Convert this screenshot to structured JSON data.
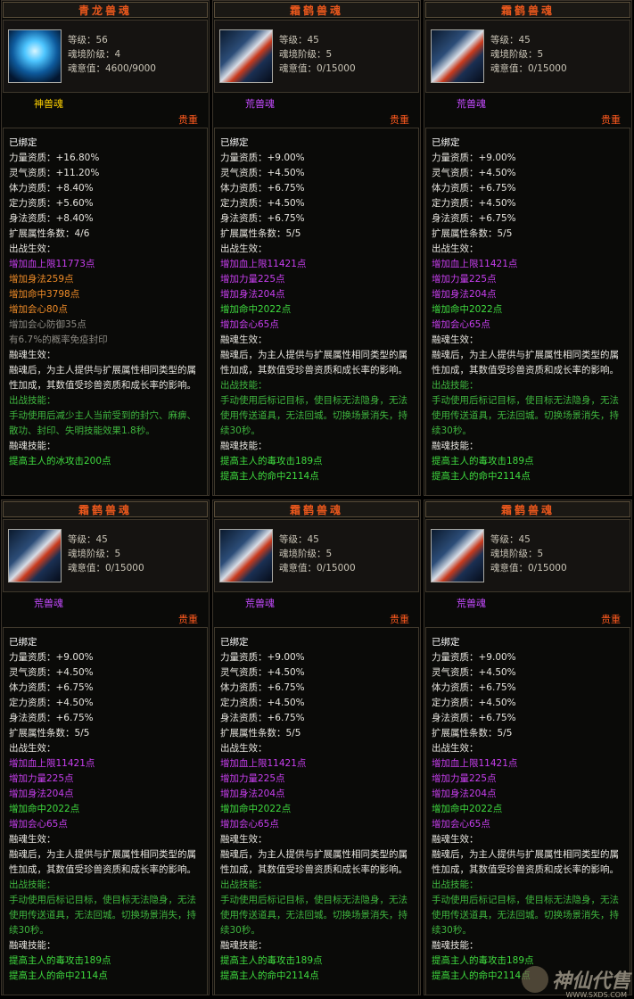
{
  "cards": [
    {
      "title": "青龙兽魂",
      "icon": "azure-dragon-soul-icon",
      "level": "等级：56",
      "stage": "魂境阶级：4",
      "soul_value": "魂意值：4600/9000",
      "type": "神兽魂",
      "rarity": "贵重",
      "bound": "已绑定",
      "attrs": [
        "力量资质：+16.80%",
        "灵气资质：+11.20%",
        "体力资质：+8.40%",
        "定力资质：+5.60%",
        "身法资质：+8.40%"
      ],
      "ext_count": "扩展属性条数：4/6",
      "battle_effect_label": "出战生效：",
      "effects": [
        {
          "text": "增加血上限11773点",
          "color": "p"
        },
        {
          "text": "增加身法259点",
          "color": "o"
        },
        {
          "text": "增加命中3798点",
          "color": "o"
        },
        {
          "text": "增加会心80点",
          "color": "o"
        },
        {
          "text": "增加会心防御35点",
          "color": "gr"
        },
        {
          "text": "有6.7%的概率免疫封印",
          "color": "gr"
        }
      ],
      "fusion_label": "融魂生效：",
      "fusion_text": "融魂后，为主人提供与扩展属性相同类型的属性加成，其数值受珍兽资质和成长率的影响。",
      "battle_skill_label": "出战技能：",
      "battle_skill_text": "手动使用后减少主人当前受到的封穴、麻痹、散功、封印、失明技能效果1.8秒。",
      "fusion_skill_label": "融魂技能：",
      "fusion_skill_lines": [
        "提高主人的冰攻击200点"
      ]
    },
    {
      "title": "霜鹤兽魂",
      "icon": "frost-crane-soul-icon",
      "level": "等级：45",
      "stage": "魂境阶级：5",
      "soul_value": "魂意值：0/15000",
      "type": "荒兽魂",
      "rarity": "贵重",
      "bound": "已绑定",
      "attrs": [
        "力量资质：+9.00%",
        "灵气资质：+4.50%",
        "体力资质：+6.75%",
        "定力资质：+4.50%",
        "身法资质：+6.75%"
      ],
      "ext_count": "扩展属性条数：5/5",
      "battle_effect_label": "出战生效：",
      "effects": [
        {
          "text": "增加血上限11421点",
          "color": "p"
        },
        {
          "text": "增加力量225点",
          "color": "p"
        },
        {
          "text": "增加身法204点",
          "color": "p"
        },
        {
          "text": "增加命中2022点",
          "color": "g"
        },
        {
          "text": "增加会心65点",
          "color": "p"
        }
      ],
      "fusion_label": "融魂生效：",
      "fusion_text": "融魂后，为主人提供与扩展属性相同类型的属性加成，其数值受珍兽资质和成长率的影响。",
      "battle_skill_label": "出战技能：",
      "battle_skill_text": "手动使用后标记目标，使目标无法隐身，无法使用传送道具，无法回城。切换场景消失，持续30秒。",
      "fusion_skill_label": "融魂技能：",
      "fusion_skill_lines": [
        "提高主人的毒攻击189点",
        "提高主人的命中2114点"
      ]
    }
  ],
  "watermark": {
    "text": "神仙代售",
    "url": "WWW.SXDS.COM"
  }
}
